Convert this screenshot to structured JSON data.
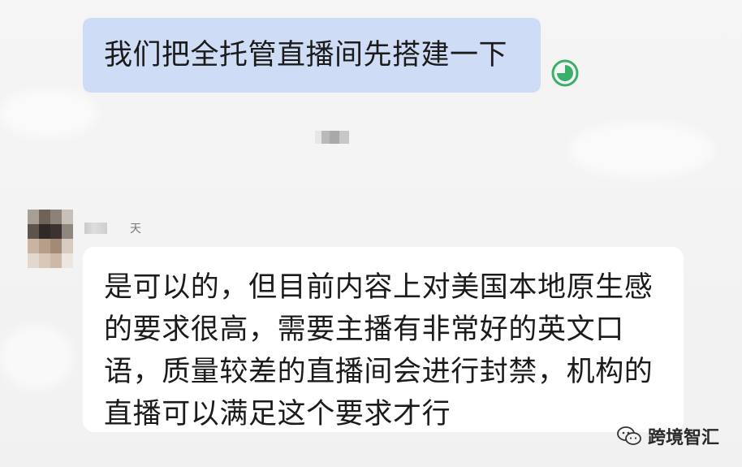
{
  "messages": {
    "outgoing": {
      "text": "我们把全托管直播间先搭建一下"
    },
    "incoming": {
      "sender_suffix": "天",
      "lines": [
        "是可以的，但目前内容上对美国本地原生感",
        "的要求很高，需要主播有非常好的英文口",
        "语，质量较差的直播间会进行封禁，机构的",
        "直播可以满足这个要求才行"
      ]
    }
  },
  "watermark": {
    "text": "跨境智汇"
  },
  "colors": {
    "outgoing_bubble": "#cfdcf6",
    "incoming_bubble": "#ffffff",
    "read_status": "#3aaf6a",
    "background": "#f3f3f3"
  },
  "icons": {
    "read_status": "read-status-icon",
    "watermark": "wechat-icon"
  }
}
